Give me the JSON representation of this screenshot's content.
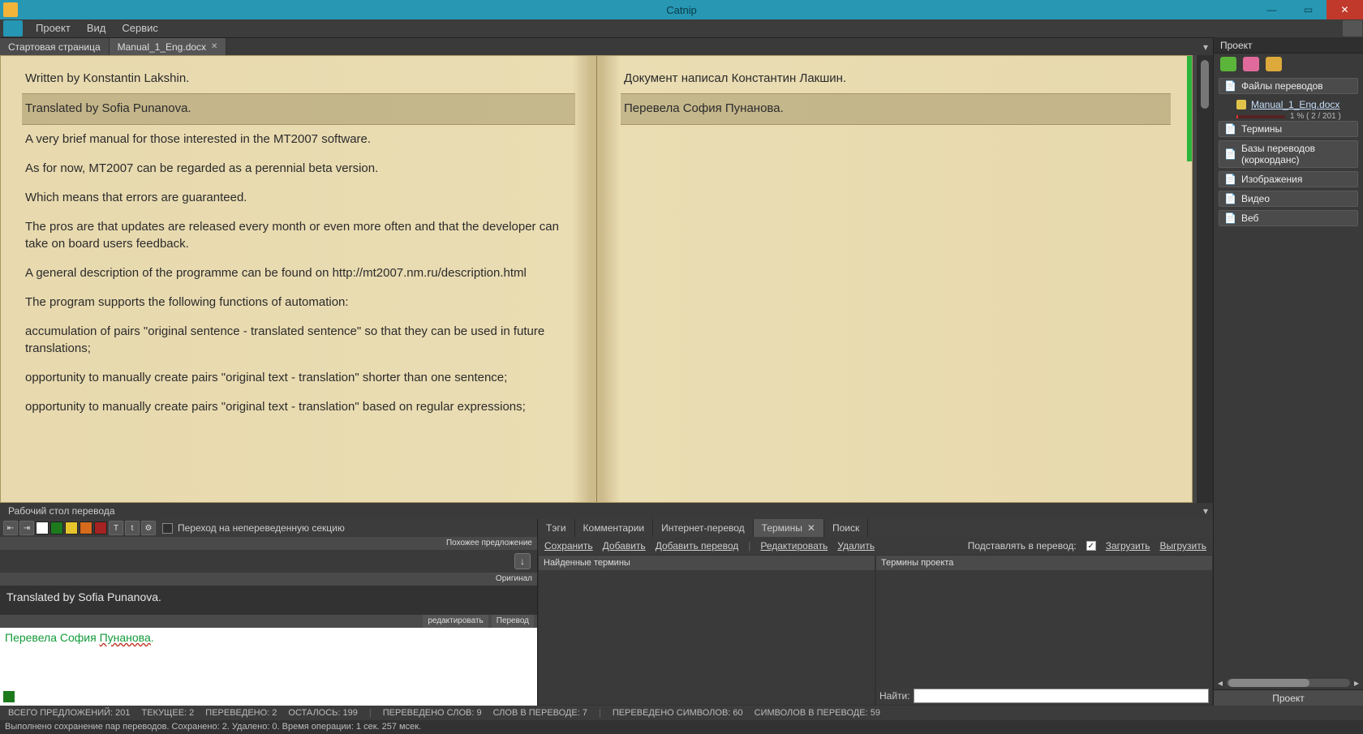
{
  "title": "Catnip",
  "menu": {
    "project": "Проект",
    "view": "Вид",
    "service": "Сервис"
  },
  "tabs": {
    "start": "Стартовая страница",
    "doc": "Manual_1_Eng.docx"
  },
  "segments": {
    "left": [
      "Written by Konstantin Lakshin.",
      "Translated by Sofia Punanova.",
      "A very brief manual for those interested in the MT2007 software.",
      "As for now, MT2007 can be regarded as a perennial beta version.",
      "Which means that errors are guaranteed.",
      "The pros are that updates are released every month or even more often and that the developer can take on board users feedback.",
      "A general description of the programme can be found on http://mt2007.nm.ru/description.html",
      "The program supports the following functions of automation:",
      "accumulation of pairs \"original sentence - translated sentence\" so that they can be used in future translations;",
      "opportunity to manually create pairs \"original text - translation\" shorter than one sentence;",
      "opportunity to manually create pairs \"original text - translation\" based on regular expressions;"
    ],
    "right": [
      "Документ написал Константин Лакшин.",
      "Перевела София Пунанова."
    ]
  },
  "workbench_title": "Рабочий стол перевода",
  "goto_untranslated": "Переход на непереведенную секцию",
  "similar_label": "Похожее предложение",
  "original_label": "Оригинал",
  "edit_label": "редактировать",
  "translate_label": "Перевод",
  "original_text": "Translated by Sofia Punanova.",
  "edit_prefix": "Перевела София ",
  "edit_underlined": "Пунанова",
  "edit_suffix": ".",
  "wbr_tabs": {
    "tags": "Тэги",
    "comments": "Комментарии",
    "internet": "Интернет-перевод",
    "terms": "Термины",
    "search": "Поиск"
  },
  "term_links": {
    "save": "Сохранить",
    "add": "Добавить",
    "add_tr": "Добавить перевод",
    "edit": "Редактировать",
    "del": "Удалить",
    "insert_label": "Подставлять в перевод:",
    "load": "Загрузить",
    "unload": "Выгрузить"
  },
  "term_cols": {
    "found": "Найденные термины",
    "project": "Термины проекта"
  },
  "find_label": "Найти:",
  "project_panel": {
    "title": "Проект",
    "groups": {
      "files": "Файлы переводов",
      "terms": "Термины",
      "tm": "Базы переводов (коркорданс)",
      "images": "Изображения",
      "video": "Видео",
      "web": "Веб"
    },
    "file": "Manual_1_Eng.docx",
    "progress": "1 %  ( 2 / 201 )",
    "footer": "Проект"
  },
  "status": {
    "total": "ВСЕГО ПРЕДЛОЖЕНИЙ: 201",
    "current": "ТЕКУЩЕЕ: 2",
    "translated": "ПЕРЕВЕДЕНО: 2",
    "left": "ОСТАЛОСЬ: 199",
    "words_tr": "ПЕРЕВЕДЕНО СЛОВ: 9",
    "words_in": "СЛОВ В ПЕРЕВОДЕ: 7",
    "chars_tr": "ПЕРЕВЕДЕНО СИМВОЛОВ: 60",
    "chars_in": "СИМВОЛОВ В ПЕРЕВОДЕ: 59"
  },
  "footer": "Выполнено сохранение пар переводов. Сохранено: 2. Удалено: 0. Время операции: 1 сек. 257 мсек."
}
